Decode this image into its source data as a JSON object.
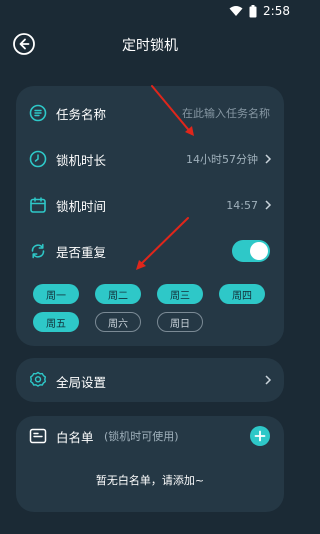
{
  "status": {
    "time": "2:58"
  },
  "header": {
    "title": "定时锁机"
  },
  "task": {
    "label": "任务名称",
    "placeholder": "在此输入任务名称"
  },
  "duration": {
    "label": "锁机时长",
    "value": "14小时57分钟"
  },
  "lock_time": {
    "label": "锁机时间",
    "value": "14:57"
  },
  "repeat": {
    "label": "是否重复",
    "enabled": true
  },
  "days": [
    {
      "label": "周一",
      "selected": true
    },
    {
      "label": "周二",
      "selected": true
    },
    {
      "label": "周三",
      "selected": true
    },
    {
      "label": "周四",
      "selected": true
    },
    {
      "label": "周五",
      "selected": true
    },
    {
      "label": "周六",
      "selected": false
    },
    {
      "label": "周日",
      "selected": false
    }
  ],
  "settings": {
    "label": "全局设置"
  },
  "whitelist": {
    "title": "白名单",
    "subtitle": "(锁机时可使用)",
    "empty_text": "暂无白名单，请添加~"
  },
  "colors": {
    "accent": "#2ec8c8",
    "background": "#1b2a35",
    "card": "#253845",
    "arrow": "#e0261b"
  }
}
